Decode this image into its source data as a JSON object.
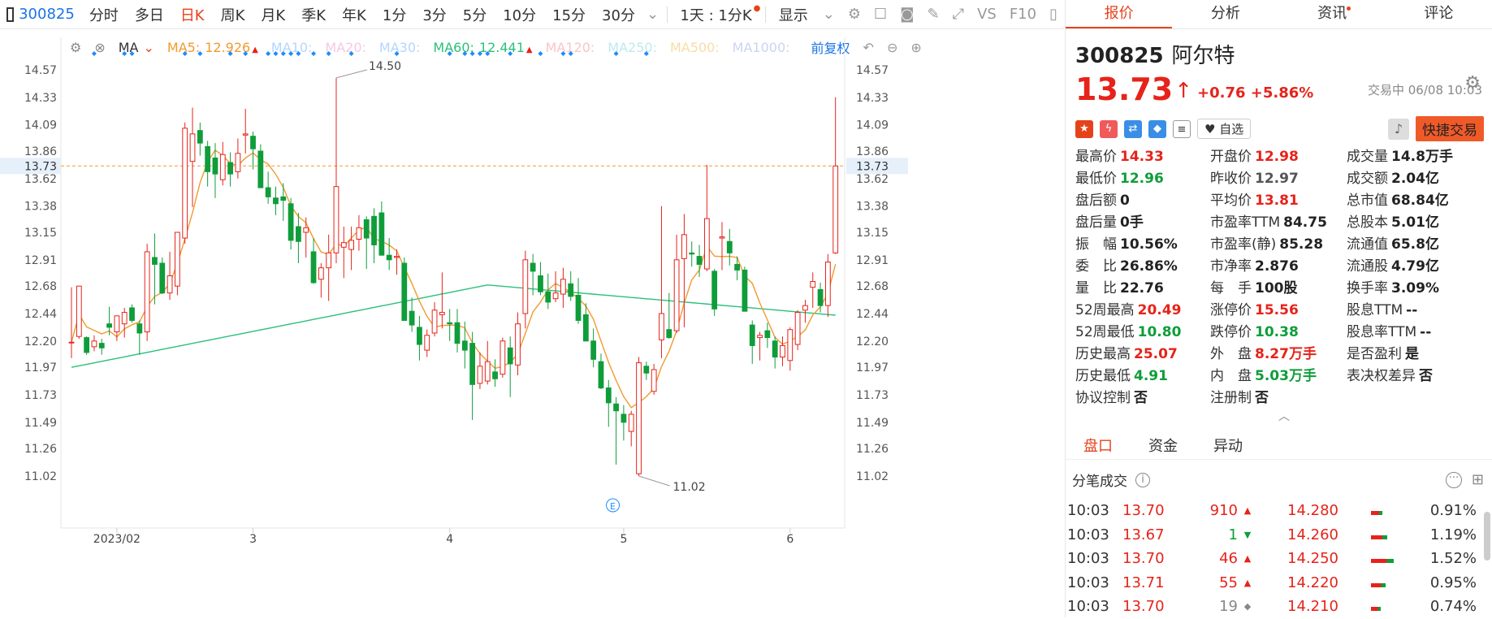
{
  "toolbar": {
    "code": "300825",
    "items": [
      "分时",
      "多日",
      "日K",
      "周K",
      "月K",
      "季K",
      "年K",
      "1分",
      "3分",
      "5分",
      "10分",
      "15分",
      "30分"
    ],
    "active": "日K",
    "range": "1天 : 1分K",
    "display": "显示",
    "vs": "VS",
    "f10": "F10"
  },
  "ma_bar": {
    "type": "MA",
    "ma5_label": "MA5:",
    "ma5_value": "12.926",
    "ma10": "MA10:",
    "ma20": "MA20:",
    "ma30": "MA30:",
    "ma60_label": "MA60:",
    "ma60_value": "12.441",
    "ma120": "MA120:",
    "ma250": "MA250:",
    "ma500": "MA500:",
    "ma1000": "MA1000:",
    "adjust": "前复权"
  },
  "chart_data": {
    "type": "candlestick",
    "y_ticks": [
      "14.57",
      "14.33",
      "14.09",
      "13.86",
      "13.62",
      "13.38",
      "13.15",
      "12.91",
      "12.68",
      "12.44",
      "12.20",
      "11.97",
      "11.73",
      "11.49",
      "11.26",
      "11.02"
    ],
    "ylim": [
      11.02,
      14.57
    ],
    "x_labels": [
      "2023/02",
      "3",
      "4",
      "5",
      "6"
    ],
    "current_price_label": "13.73",
    "high_annotation": "14.50",
    "low_annotation": "11.02",
    "ma_colors": {
      "ma5": "#f29a2e",
      "ma60": "#2bc07a"
    },
    "up_color": "#e6231a",
    "down_color": "#0f9d3a",
    "candles": [
      {
        "o": 12.19,
        "h": 12.67,
        "l": 12.05,
        "c": 12.19
      },
      {
        "o": 12.24,
        "h": 12.68,
        "l": 12.22,
        "c": 12.68
      },
      {
        "o": 12.23,
        "h": 12.24,
        "l": 12.08,
        "c": 12.1
      },
      {
        "o": 12.15,
        "h": 12.25,
        "l": 12.11,
        "c": 12.2
      },
      {
        "o": 12.18,
        "h": 12.22,
        "l": 12.08,
        "c": 12.14
      },
      {
        "o": 12.35,
        "h": 12.5,
        "l": 12.25,
        "c": 12.32
      },
      {
        "o": 12.28,
        "h": 12.4,
        "l": 12.2,
        "c": 12.42
      },
      {
        "o": 12.35,
        "h": 12.49,
        "l": 12.23,
        "c": 12.45
      },
      {
        "o": 12.49,
        "h": 12.52,
        "l": 12.36,
        "c": 12.38
      },
      {
        "o": 12.35,
        "h": 12.38,
        "l": 12.08,
        "c": 12.27
      },
      {
        "o": 12.28,
        "h": 13.05,
        "l": 12.2,
        "c": 12.98
      },
      {
        "o": 12.93,
        "h": 13.14,
        "l": 12.52,
        "c": 12.87
      },
      {
        "o": 12.88,
        "h": 12.93,
        "l": 12.61,
        "c": 12.62
      },
      {
        "o": 12.62,
        "h": 12.98,
        "l": 12.56,
        "c": 12.77
      },
      {
        "o": 12.68,
        "h": 13.15,
        "l": 12.6,
        "c": 13.15
      },
      {
        "o": 13.1,
        "h": 14.11,
        "l": 13.05,
        "c": 14.06
      },
      {
        "o": 13.77,
        "h": 14.24,
        "l": 13.37,
        "c": 14.01
      },
      {
        "o": 14.04,
        "h": 14.11,
        "l": 13.82,
        "c": 13.93
      },
      {
        "o": 13.9,
        "h": 13.95,
        "l": 13.55,
        "c": 13.68
      },
      {
        "o": 13.8,
        "h": 13.93,
        "l": 13.45,
        "c": 13.66
      },
      {
        "o": 13.61,
        "h": 13.94,
        "l": 13.56,
        "c": 13.83
      },
      {
        "o": 13.76,
        "h": 13.85,
        "l": 13.55,
        "c": 13.66
      },
      {
        "o": 13.68,
        "h": 13.97,
        "l": 13.62,
        "c": 13.84
      },
      {
        "o": 14.0,
        "h": 14.23,
        "l": 13.84,
        "c": 14.01
      },
      {
        "o": 13.99,
        "h": 14.03,
        "l": 13.7,
        "c": 13.88
      },
      {
        "o": 13.86,
        "h": 13.92,
        "l": 13.65,
        "c": 13.54
      },
      {
        "o": 13.54,
        "h": 13.68,
        "l": 13.4,
        "c": 13.46
      },
      {
        "o": 13.45,
        "h": 13.55,
        "l": 13.3,
        "c": 13.4
      },
      {
        "o": 13.46,
        "h": 13.58,
        "l": 13.25,
        "c": 13.43
      },
      {
        "o": 13.4,
        "h": 13.45,
        "l": 13.0,
        "c": 13.08
      },
      {
        "o": 13.2,
        "h": 13.32,
        "l": 12.88,
        "c": 13.07
      },
      {
        "o": 13.15,
        "h": 13.28,
        "l": 12.93,
        "c": 13.19
      },
      {
        "o": 12.98,
        "h": 13.1,
        "l": 12.7,
        "c": 12.71
      },
      {
        "o": 12.74,
        "h": 12.88,
        "l": 12.58,
        "c": 12.84
      },
      {
        "o": 12.84,
        "h": 13.13,
        "l": 12.55,
        "c": 12.97
      },
      {
        "o": 12.97,
        "h": 14.5,
        "l": 12.88,
        "c": 13.55
      },
      {
        "o": 13.02,
        "h": 13.2,
        "l": 12.75,
        "c": 13.06
      },
      {
        "o": 13.0,
        "h": 13.2,
        "l": 12.82,
        "c": 13.08
      },
      {
        "o": 13.09,
        "h": 13.3,
        "l": 12.99,
        "c": 13.19
      },
      {
        "o": 13.26,
        "h": 13.29,
        "l": 12.83,
        "c": 13.1
      },
      {
        "o": 13.29,
        "h": 13.36,
        "l": 12.88,
        "c": 13.04
      },
      {
        "o": 13.32,
        "h": 13.42,
        "l": 12.98,
        "c": 12.95
      },
      {
        "o": 12.95,
        "h": 13.1,
        "l": 12.82,
        "c": 12.91
      },
      {
        "o": 12.93,
        "h": 13.0,
        "l": 12.78,
        "c": 12.94
      },
      {
        "o": 12.88,
        "h": 12.93,
        "l": 12.44,
        "c": 12.38
      },
      {
        "o": 12.46,
        "h": 12.58,
        "l": 12.28,
        "c": 12.34
      },
      {
        "o": 12.32,
        "h": 12.42,
        "l": 12.03,
        "c": 12.17
      },
      {
        "o": 12.12,
        "h": 12.3,
        "l": 12.06,
        "c": 12.25
      },
      {
        "o": 12.27,
        "h": 12.54,
        "l": 12.24,
        "c": 12.47
      },
      {
        "o": 12.43,
        "h": 12.8,
        "l": 12.31,
        "c": 12.45
      },
      {
        "o": 12.36,
        "h": 12.48,
        "l": 12.2,
        "c": 12.35
      },
      {
        "o": 12.36,
        "h": 12.48,
        "l": 12.1,
        "c": 12.18
      },
      {
        "o": 12.2,
        "h": 12.37,
        "l": 11.96,
        "c": 12.12
      },
      {
        "o": 12.18,
        "h": 12.28,
        "l": 11.51,
        "c": 11.82
      },
      {
        "o": 11.83,
        "h": 12.1,
        "l": 11.78,
        "c": 11.98
      },
      {
        "o": 11.85,
        "h": 12.2,
        "l": 11.82,
        "c": 12.02
      },
      {
        "o": 11.93,
        "h": 12.04,
        "l": 11.8,
        "c": 11.87
      },
      {
        "o": 11.91,
        "h": 12.23,
        "l": 11.88,
        "c": 12.2
      },
      {
        "o": 12.14,
        "h": 12.24,
        "l": 11.71,
        "c": 12.0
      },
      {
        "o": 11.99,
        "h": 12.45,
        "l": 11.9,
        "c": 12.35
      },
      {
        "o": 12.44,
        "h": 12.99,
        "l": 12.31,
        "c": 12.91
      },
      {
        "o": 12.88,
        "h": 12.96,
        "l": 12.6,
        "c": 12.81
      },
      {
        "o": 12.77,
        "h": 12.89,
        "l": 12.6,
        "c": 12.63
      },
      {
        "o": 12.63,
        "h": 12.79,
        "l": 12.48,
        "c": 12.54
      },
      {
        "o": 12.57,
        "h": 12.81,
        "l": 12.54,
        "c": 12.62
      },
      {
        "o": 12.61,
        "h": 12.84,
        "l": 12.49,
        "c": 12.74
      },
      {
        "o": 12.7,
        "h": 12.81,
        "l": 12.55,
        "c": 12.59
      },
      {
        "o": 12.6,
        "h": 12.75,
        "l": 12.35,
        "c": 12.38
      },
      {
        "o": 12.43,
        "h": 12.53,
        "l": 12.2,
        "c": 12.2
      },
      {
        "o": 12.2,
        "h": 12.31,
        "l": 11.97,
        "c": 12.04
      },
      {
        "o": 12.02,
        "h": 12.09,
        "l": 11.78,
        "c": 11.79
      },
      {
        "o": 11.79,
        "h": 11.86,
        "l": 11.45,
        "c": 11.66
      },
      {
        "o": 11.65,
        "h": 11.71,
        "l": 11.12,
        "c": 11.59
      },
      {
        "o": 11.56,
        "h": 11.64,
        "l": 11.33,
        "c": 11.49
      },
      {
        "o": 11.41,
        "h": 11.59,
        "l": 11.28,
        "c": 11.56
      },
      {
        "o": 11.04,
        "h": 12.06,
        "l": 11.02,
        "c": 12.01
      },
      {
        "o": 11.98,
        "h": 12.02,
        "l": 11.86,
        "c": 11.92
      },
      {
        "o": 11.76,
        "h": 12.0,
        "l": 11.73,
        "c": 11.95
      },
      {
        "o": 12.21,
        "h": 13.38,
        "l": 12.05,
        "c": 12.44
      },
      {
        "o": 12.3,
        "h": 12.62,
        "l": 12.22,
        "c": 12.23
      },
      {
        "o": 12.29,
        "h": 13.13,
        "l": 12.27,
        "c": 12.91
      },
      {
        "o": 12.92,
        "h": 13.31,
        "l": 12.32,
        "c": 13.13
      },
      {
        "o": 12.97,
        "h": 13.07,
        "l": 12.85,
        "c": 12.96
      },
      {
        "o": 12.94,
        "h": 13.04,
        "l": 12.76,
        "c": 12.87
      },
      {
        "o": 12.83,
        "h": 13.74,
        "l": 12.81,
        "c": 13.27
      },
      {
        "o": 12.81,
        "h": 12.83,
        "l": 12.42,
        "c": 12.48
      },
      {
        "o": 13.1,
        "h": 13.24,
        "l": 12.82,
        "c": 13.11
      },
      {
        "o": 13.07,
        "h": 13.18,
        "l": 12.86,
        "c": 12.97
      },
      {
        "o": 12.87,
        "h": 12.94,
        "l": 12.73,
        "c": 12.82
      },
      {
        "o": 12.82,
        "h": 12.85,
        "l": 12.48,
        "c": 12.46
      },
      {
        "o": 12.34,
        "h": 12.38,
        "l": 12.0,
        "c": 12.16
      },
      {
        "o": 12.23,
        "h": 12.28,
        "l": 12.03,
        "c": 12.25
      },
      {
        "o": 12.29,
        "h": 12.36,
        "l": 12.14,
        "c": 12.23
      },
      {
        "o": 12.2,
        "h": 12.24,
        "l": 11.96,
        "c": 12.06
      },
      {
        "o": 12.06,
        "h": 12.24,
        "l": 11.98,
        "c": 12.16
      },
      {
        "o": 12.03,
        "h": 12.32,
        "l": 11.94,
        "c": 12.3
      },
      {
        "o": 12.17,
        "h": 12.47,
        "l": 12.12,
        "c": 12.45
      },
      {
        "o": 12.47,
        "h": 12.56,
        "l": 12.36,
        "c": 12.51
      },
      {
        "o": 12.67,
        "h": 12.8,
        "l": 12.49,
        "c": 12.72
      },
      {
        "o": 12.65,
        "h": 12.71,
        "l": 12.45,
        "c": 12.51
      },
      {
        "o": 12.51,
        "h": 12.96,
        "l": 12.41,
        "c": 12.89
      },
      {
        "o": 12.97,
        "h": 14.33,
        "l": 12.96,
        "c": 13.73
      }
    ]
  },
  "right": {
    "tabs": [
      "报价",
      "分析",
      "资讯",
      "评论"
    ],
    "code": "300825",
    "name": "阿尔特",
    "price": "13.73",
    "change": "+0.76 +5.86%",
    "trade_time": "交易中 06/08 10:03",
    "zixuan": "自选",
    "quick_trade": "快捷交易",
    "quotes": [
      [
        {
          "k": "最高价",
          "v": "14.33",
          "c": "red"
        },
        {
          "k": "开盘价",
          "v": "12.98",
          "c": "red"
        },
        {
          "k": "成交量",
          "v": "14.8万手",
          "c": "dark"
        }
      ],
      [
        {
          "k": "最低价",
          "v": "12.96",
          "c": "green"
        },
        {
          "k": "昨收价",
          "v": "12.97",
          "c": "gray"
        },
        {
          "k": "成交额",
          "v": "2.04亿",
          "c": "dark"
        }
      ],
      [
        {
          "k": "盘后额",
          "v": "0",
          "c": "dark"
        },
        {
          "k": "平均价",
          "v": "13.81",
          "c": "red"
        },
        {
          "k": "总市值",
          "v": "68.84亿",
          "c": "dark"
        }
      ],
      [
        {
          "k": "盘后量",
          "v": "0手",
          "c": "dark"
        },
        {
          "k": "市盈率TTM",
          "v": "84.75",
          "c": "dark"
        },
        {
          "k": "总股本",
          "v": "5.01亿",
          "c": "dark"
        }
      ],
      [
        {
          "k": "振　幅",
          "v": "10.56%",
          "c": "dark"
        },
        {
          "k": "市盈率(静)",
          "v": "85.28",
          "c": "dark"
        },
        {
          "k": "流通值",
          "v": "65.8亿",
          "c": "dark"
        }
      ],
      [
        {
          "k": "委　比",
          "v": "26.86%",
          "c": "dark"
        },
        {
          "k": "市净率",
          "v": "2.876",
          "c": "dark"
        },
        {
          "k": "流通股",
          "v": "4.79亿",
          "c": "dark"
        }
      ],
      [
        {
          "k": "量　比",
          "v": "22.76",
          "c": "dark"
        },
        {
          "k": "每　手",
          "v": "100股",
          "c": "dark"
        },
        {
          "k": "换手率",
          "v": "3.09%",
          "c": "dark"
        }
      ],
      [
        {
          "k": "52周最高",
          "v": "20.49",
          "c": "red"
        },
        {
          "k": "涨停价",
          "v": "15.56",
          "c": "red"
        },
        {
          "k": "股息TTM",
          "v": "--",
          "c": "dark"
        }
      ],
      [
        {
          "k": "52周最低",
          "v": "10.80",
          "c": "green"
        },
        {
          "k": "跌停价",
          "v": "10.38",
          "c": "green"
        },
        {
          "k": "股息率TTM",
          "v": "--",
          "c": "dark"
        }
      ],
      [
        {
          "k": "历史最高",
          "v": "25.07",
          "c": "red"
        },
        {
          "k": "外　盘",
          "v": "8.27万手",
          "c": "red"
        },
        {
          "k": "是否盈利",
          "v": "是",
          "c": "dark"
        }
      ],
      [
        {
          "k": "历史最低",
          "v": "4.91",
          "c": "green"
        },
        {
          "k": "内　盘",
          "v": "5.03万手",
          "c": "green"
        },
        {
          "k": "表决权差异",
          "v": "否",
          "c": "dark"
        }
      ],
      [
        {
          "k": "协议控制",
          "v": "否",
          "c": "dark"
        },
        {
          "k": "注册制",
          "v": "否",
          "c": "dark"
        },
        {
          "k": "",
          "v": "",
          "c": "dark"
        }
      ]
    ],
    "subtabs": [
      "盘口",
      "资金",
      "异动"
    ],
    "tick_title": "分笔成交",
    "ticks": [
      {
        "t": "10:03",
        "p": "13.70",
        "v": "910",
        "d": "up",
        "lp": "14.280",
        "pct": "0.91%",
        "bar": 0.35
      },
      {
        "t": "10:03",
        "p": "13.67",
        "v": "1",
        "d": "down",
        "lp": "14.260",
        "pct": "1.19%",
        "bar": 0.5
      },
      {
        "t": "10:03",
        "p": "13.70",
        "v": "46",
        "d": "up",
        "lp": "14.250",
        "pct": "1.52%",
        "bar": 0.7
      },
      {
        "t": "10:03",
        "p": "13.71",
        "v": "55",
        "d": "up",
        "lp": "14.220",
        "pct": "0.95%",
        "bar": 0.45
      },
      {
        "t": "10:03",
        "p": "13.70",
        "v": "19",
        "d": "flat",
        "lp": "14.210",
        "pct": "0.74%",
        "bar": 0.3
      }
    ]
  }
}
